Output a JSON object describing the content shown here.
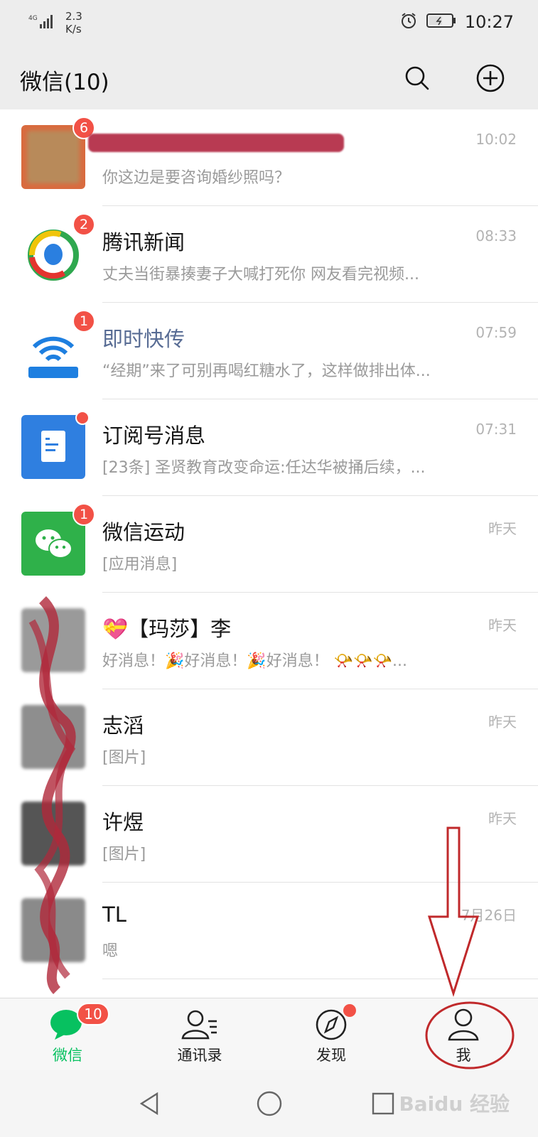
{
  "status_bar": {
    "network_type": "4G",
    "speed_value": "2.3",
    "speed_unit": "K/s",
    "time": "10:27"
  },
  "header": {
    "title": "微信(10)",
    "search_icon": "search-icon",
    "add_icon": "plus-circle-icon"
  },
  "chats": [
    {
      "name": "",
      "preview": "你这边是要咨询婚纱照吗？",
      "time": "10:02",
      "badge": "6",
      "avatar_color": "#d96b3f"
    },
    {
      "name": "腾讯新闻",
      "preview": "丈夫当街暴揍妻子大喊打死你 网友看完视频...",
      "time": "08:33",
      "badge": "2",
      "avatar_color": "#ffffff"
    },
    {
      "name": "即时快传",
      "preview": "“经期”来了可别再喝红糖水了，这样做排出体...",
      "time": "07:59",
      "badge": "1",
      "avatar_color": "#ffffff"
    },
    {
      "name": "订阅号消息",
      "preview": "[23条] 圣贤教育改变命运:任达华被捅后续，...",
      "time": "07:31",
      "badge": "",
      "avatar_color": "#2f7fe0"
    },
    {
      "name": "微信运动",
      "preview": "[应用消息]",
      "time": "昨天",
      "badge": "1",
      "avatar_color": "#2fb14a"
    },
    {
      "name": "【玛莎】李",
      "preview": "好消息！🎉好消息！🎉好消息！ 📯📯📯...",
      "time": "昨天",
      "badge": "",
      "avatar_color": "#9a9a9a"
    },
    {
      "name": "志滔",
      "preview": "[图片]",
      "time": "昨天",
      "badge": "",
      "avatar_color": "#8e8e8e"
    },
    {
      "name": "许煜",
      "preview": "[图片]",
      "time": "昨天",
      "badge": "",
      "avatar_color": "#7a7a7a"
    },
    {
      "name": "TL",
      "preview": "嗯",
      "time": "7月26日",
      "badge": "",
      "avatar_color": "#8a8a8a"
    }
  ],
  "tabs": [
    {
      "label": "微信",
      "icon": "chat-bubble-icon",
      "badge": "10"
    },
    {
      "label": "通讯录",
      "icon": "contacts-icon"
    },
    {
      "label": "发现",
      "icon": "compass-icon",
      "dot": true
    },
    {
      "label": "我",
      "icon": "person-icon"
    }
  ],
  "nav_bar": {
    "back_icon": "triangle-back-icon",
    "home_icon": "circle-home-icon",
    "recent_icon": "square-recent-icon"
  },
  "watermark": "Baidu 经验",
  "colors": {
    "accent_green": "#07c160",
    "badge_red": "#f25146",
    "annotation_red": "#c0292b"
  }
}
